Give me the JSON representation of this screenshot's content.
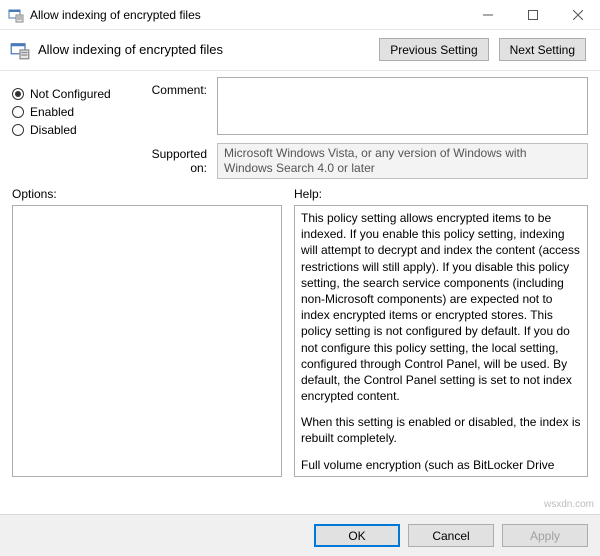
{
  "titlebar": {
    "title": "Allow indexing of encrypted files"
  },
  "header": {
    "title": "Allow indexing of encrypted files",
    "previous_setting": "Previous Setting",
    "next_setting": "Next Setting"
  },
  "state": {
    "selected": "Not Configured",
    "not_configured": "Not Configured",
    "enabled": "Enabled",
    "disabled": "Disabled"
  },
  "labels": {
    "comment": "Comment:",
    "supported_on": "Supported on:",
    "options": "Options:",
    "help": "Help:"
  },
  "fields": {
    "comment_value": "",
    "supported_value": "Microsoft Windows Vista, or any version of Windows with Windows Search 4.0 or later"
  },
  "help": {
    "p1": "This policy setting allows encrypted items to be indexed. If you enable this policy setting, indexing  will attempt to decrypt and index the content (access restrictions will still apply). If you disable this policy setting, the search service components (including non-Microsoft components) are expected not to index encrypted items or encrypted stores. This policy setting is not configured by default. If you do not configure this policy setting, the local setting, configured through Control Panel, will be used. By default, the Control Panel setting is set to not index encrypted content.",
    "p2": "When this setting is enabled or disabled, the index is rebuilt completely.",
    "p3": "Full volume encryption (such as BitLocker Drive Encryption or a non-Microsoft solution) must be used for the location of the index to maintain security for encrypted files."
  },
  "footer": {
    "ok": "OK",
    "cancel": "Cancel",
    "apply": "Apply"
  },
  "watermark": "wsxdn.com"
}
